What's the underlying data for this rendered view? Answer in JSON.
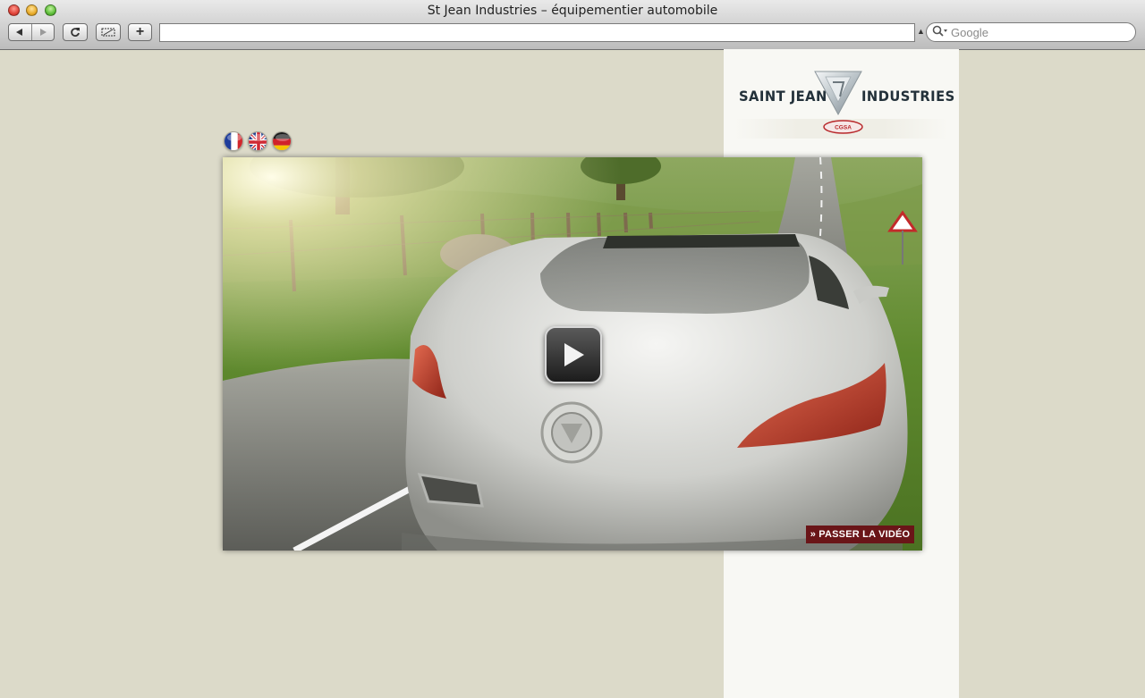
{
  "window": {
    "title": "St Jean Industries – équipementier automobile"
  },
  "toolbar": {
    "back_icon": "back-arrow-icon",
    "forward_icon": "forward-arrow-icon",
    "reload_icon": "reload-icon",
    "snapshot_icon": "web-clip-icon",
    "add_label": "+",
    "address_value": "",
    "search_placeholder": "Google"
  },
  "brand": {
    "name_left": "SAINT JEAN",
    "name_right": "INDUSTRIES",
    "subbrand": "CGSA"
  },
  "languages": [
    {
      "name": "Français",
      "icon": "france-flag-icon"
    },
    {
      "name": "English",
      "icon": "uk-flag-icon"
    },
    {
      "name": "Deutsch",
      "icon": "germany-flag-icon"
    }
  ],
  "video": {
    "play_icon": "play-icon",
    "skip_label": "» PASSER LA VIDÉO"
  },
  "colors": {
    "page_background": "#dcdac9",
    "side_panel": "#f8f8f4",
    "skip_button": "#6a1518",
    "brand_text": "#23313a"
  }
}
